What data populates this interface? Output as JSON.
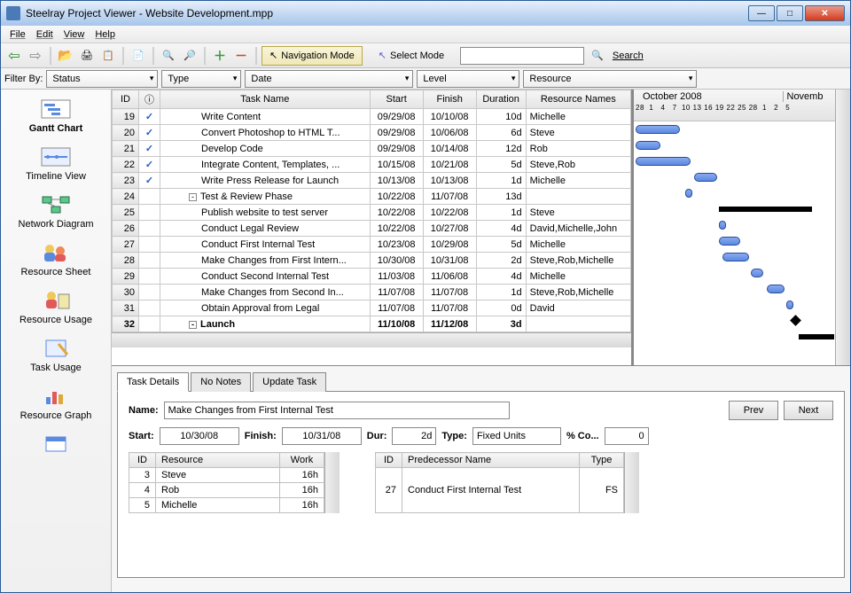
{
  "window": {
    "title": "Steelray Project Viewer - Website Development.mpp"
  },
  "menu": [
    "File",
    "Edit",
    "View",
    "Help"
  ],
  "toolbar": {
    "nav_mode": "Navigation Mode",
    "select_mode": "Select Mode",
    "search_label": "Search"
  },
  "filter": {
    "label": "Filter By:",
    "status": "Status",
    "type": "Type",
    "date": "Date",
    "level": "Level",
    "resource": "Resource"
  },
  "sidebar": [
    {
      "label": "Gantt Chart",
      "name": "gantt-chart"
    },
    {
      "label": "Timeline View",
      "name": "timeline-view"
    },
    {
      "label": "Network Diagram",
      "name": "network-diagram"
    },
    {
      "label": "Resource Sheet",
      "name": "resource-sheet"
    },
    {
      "label": "Resource Usage",
      "name": "resource-usage"
    },
    {
      "label": "Task Usage",
      "name": "task-usage"
    },
    {
      "label": "Resource Graph",
      "name": "resource-graph"
    }
  ],
  "grid": {
    "headers": {
      "id": "ID",
      "info": "ⓘ",
      "name": "Task Name",
      "start": "Start",
      "finish": "Finish",
      "duration": "Duration",
      "resources": "Resource Names"
    },
    "rows": [
      {
        "id": "19",
        "check": true,
        "indent": 3,
        "name": "Write Content",
        "start": "09/29/08",
        "finish": "10/10/08",
        "dur": "10d",
        "res": "Michelle"
      },
      {
        "id": "20",
        "check": true,
        "indent": 3,
        "name": "Convert Photoshop to HTML T...",
        "start": "09/29/08",
        "finish": "10/06/08",
        "dur": "6d",
        "res": "Steve"
      },
      {
        "id": "21",
        "check": true,
        "indent": 3,
        "name": "Develop Code",
        "start": "09/29/08",
        "finish": "10/14/08",
        "dur": "12d",
        "res": "Rob"
      },
      {
        "id": "22",
        "check": true,
        "indent": 3,
        "name": "Integrate Content, Templates, ...",
        "start": "10/15/08",
        "finish": "10/21/08",
        "dur": "5d",
        "res": "Steve,Rob"
      },
      {
        "id": "23",
        "check": true,
        "indent": 3,
        "name": "Write Press Release for Launch",
        "start": "10/13/08",
        "finish": "10/13/08",
        "dur": "1d",
        "res": "Michelle"
      },
      {
        "id": "24",
        "check": false,
        "indent": 2,
        "outline": "-",
        "name": "Test & Review Phase",
        "start": "10/22/08",
        "finish": "11/07/08",
        "dur": "13d",
        "res": ""
      },
      {
        "id": "25",
        "check": false,
        "indent": 3,
        "name": "Publish website to test server",
        "start": "10/22/08",
        "finish": "10/22/08",
        "dur": "1d",
        "res": "Steve"
      },
      {
        "id": "26",
        "check": false,
        "indent": 3,
        "name": "Conduct Legal Review",
        "start": "10/22/08",
        "finish": "10/27/08",
        "dur": "4d",
        "res": "David,Michelle,John"
      },
      {
        "id": "27",
        "check": false,
        "indent": 3,
        "name": "Conduct First Internal Test",
        "start": "10/23/08",
        "finish": "10/29/08",
        "dur": "5d",
        "res": "Michelle"
      },
      {
        "id": "28",
        "check": false,
        "indent": 3,
        "name": "Make Changes from First Intern...",
        "start": "10/30/08",
        "finish": "10/31/08",
        "dur": "2d",
        "res": "Steve,Rob,Michelle"
      },
      {
        "id": "29",
        "check": false,
        "indent": 3,
        "name": "Conduct Second Internal Test",
        "start": "11/03/08",
        "finish": "11/06/08",
        "dur": "4d",
        "res": "Michelle"
      },
      {
        "id": "30",
        "check": false,
        "indent": 3,
        "name": "Make Changes from Second In...",
        "start": "11/07/08",
        "finish": "11/07/08",
        "dur": "1d",
        "res": "Steve,Rob,Michelle"
      },
      {
        "id": "31",
        "check": false,
        "indent": 3,
        "name": "Obtain Approval from Legal",
        "start": "11/07/08",
        "finish": "11/07/08",
        "dur": "0d",
        "res": "David"
      },
      {
        "id": "32",
        "check": false,
        "indent": 2,
        "outline": "-",
        "bold": true,
        "name": "Launch",
        "start": "11/10/08",
        "finish": "11/12/08",
        "dur": "3d",
        "res": ""
      }
    ]
  },
  "gantt": {
    "month1": "October 2008",
    "month2": "Novemb",
    "days": "28  1   4   7  10 13 16 19 22 25 28  1   2   5"
  },
  "detail_tabs": [
    "Task Details",
    "No Notes",
    "Update Task"
  ],
  "details": {
    "name_label": "Name:",
    "name_value": "Make Changes from First Internal Test",
    "start_label": "Start:",
    "start_value": "10/30/08",
    "finish_label": "Finish:",
    "finish_value": "10/31/08",
    "dur_label": "Dur:",
    "dur_value": "2d",
    "type_label": "Type:",
    "type_value": "Fixed Units",
    "pct_label": "% Co...",
    "pct_value": "0",
    "prev": "Prev",
    "next": "Next",
    "res_headers": {
      "id": "ID",
      "name": "Resource",
      "work": "Work"
    },
    "resources": [
      {
        "id": "3",
        "name": "Steve",
        "work": "16h"
      },
      {
        "id": "4",
        "name": "Rob",
        "work": "16h"
      },
      {
        "id": "5",
        "name": "Michelle",
        "work": "16h"
      }
    ],
    "pred_headers": {
      "id": "ID",
      "name": "Predecessor Name",
      "type": "Type"
    },
    "predecessors": [
      {
        "id": "27",
        "name": "Conduct First Internal Test",
        "type": "FS"
      }
    ]
  }
}
